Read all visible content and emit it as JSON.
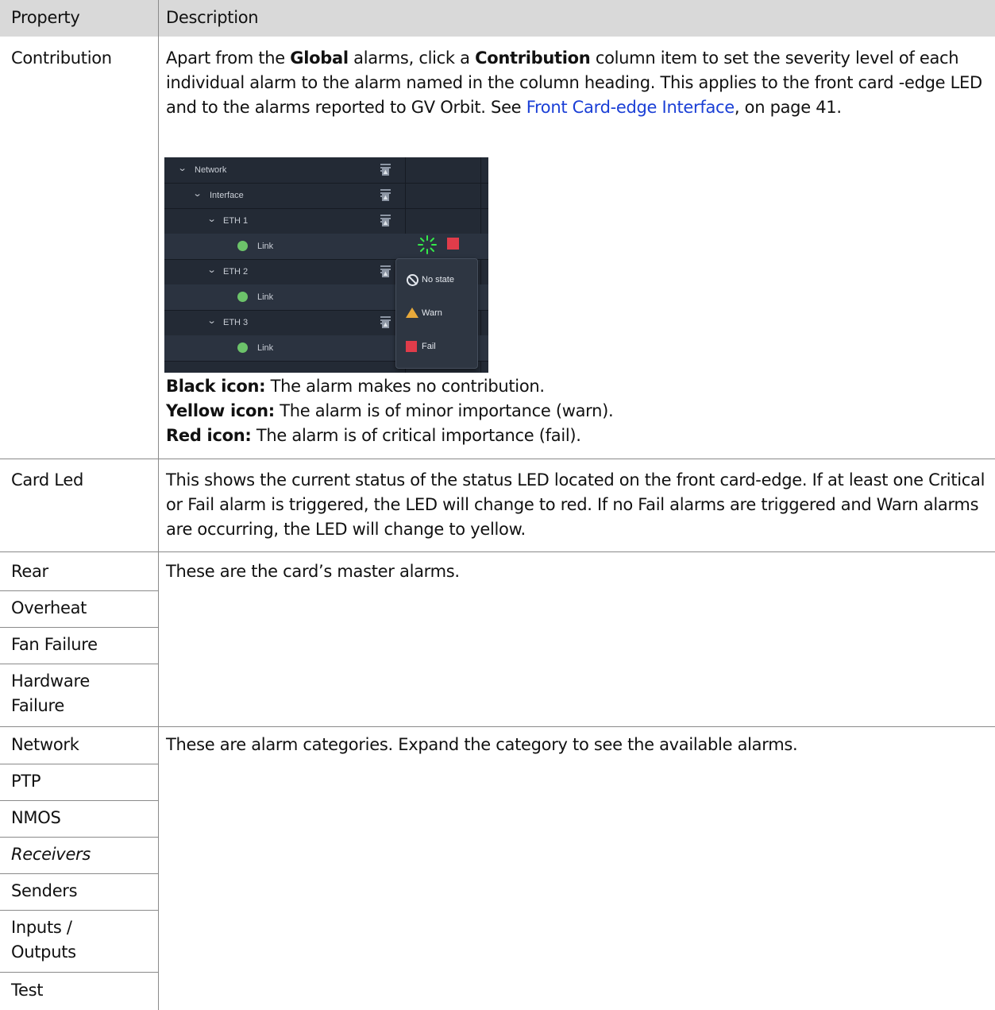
{
  "table": {
    "headers": {
      "property": "Property",
      "description": "Description"
    },
    "rows": {
      "contribution": {
        "property": "Contribution",
        "desc_parts": {
          "p1": "Apart from the ",
          "b1": "Global",
          "p2": " alarms, click a ",
          "b2": "Contribution",
          "p3": " column item to set the severity level of each individual alarm to the alarm named in the column heading. This applies to the front card -edge LED and to the alarms reported to GV Orbit. See ",
          "link": "Front Card-edge Interface",
          "p4": ", on page 41."
        },
        "notes": [
          {
            "label": "Black icon:",
            "text": " The alarm makes no contribution."
          },
          {
            "label": "Yellow icon:",
            "text": " The alarm is of minor importance (warn)."
          },
          {
            "label": "Red icon:",
            "text": " The alarm is of critical importance (fail)."
          }
        ]
      },
      "card_led": {
        "property": "Card Led",
        "description": "This shows the current status of the status LED located on the front card-edge. If at least one Critical or Fail alarm is triggered, the LED will change to red. If no Fail alarms are triggered and Warn alarms are occurring, the LED will change to yellow."
      },
      "master": {
        "properties": [
          "Rear",
          "Overheat",
          "Fan Failure",
          "Hardware Failure"
        ],
        "description": "These are the card’s master alarms."
      },
      "categories": {
        "properties": [
          "Network",
          "PTP",
          "NMOS",
          "Receivers",
          "Senders",
          "Inputs / Outputs",
          "Test"
        ],
        "description": "These are alarm categories. Expand the category to see the available alarms."
      }
    }
  },
  "screenshot": {
    "tree": [
      {
        "label": "Network",
        "type": "group"
      },
      {
        "label": "Interface",
        "type": "group"
      },
      {
        "label": "ETH 1",
        "type": "group"
      },
      {
        "label": "Link",
        "type": "item"
      },
      {
        "label": "ETH 2",
        "type": "group"
      },
      {
        "label": "Link",
        "type": "item"
      },
      {
        "label": "ETH 3",
        "type": "group"
      },
      {
        "label": "Link",
        "type": "item"
      }
    ],
    "menu": [
      "No state",
      "Warn",
      "Fail"
    ],
    "colors": {
      "bg": "#232a35",
      "dot": "#6cc36a",
      "warn": "#e8a93a",
      "fail": "#e03c4a"
    }
  }
}
